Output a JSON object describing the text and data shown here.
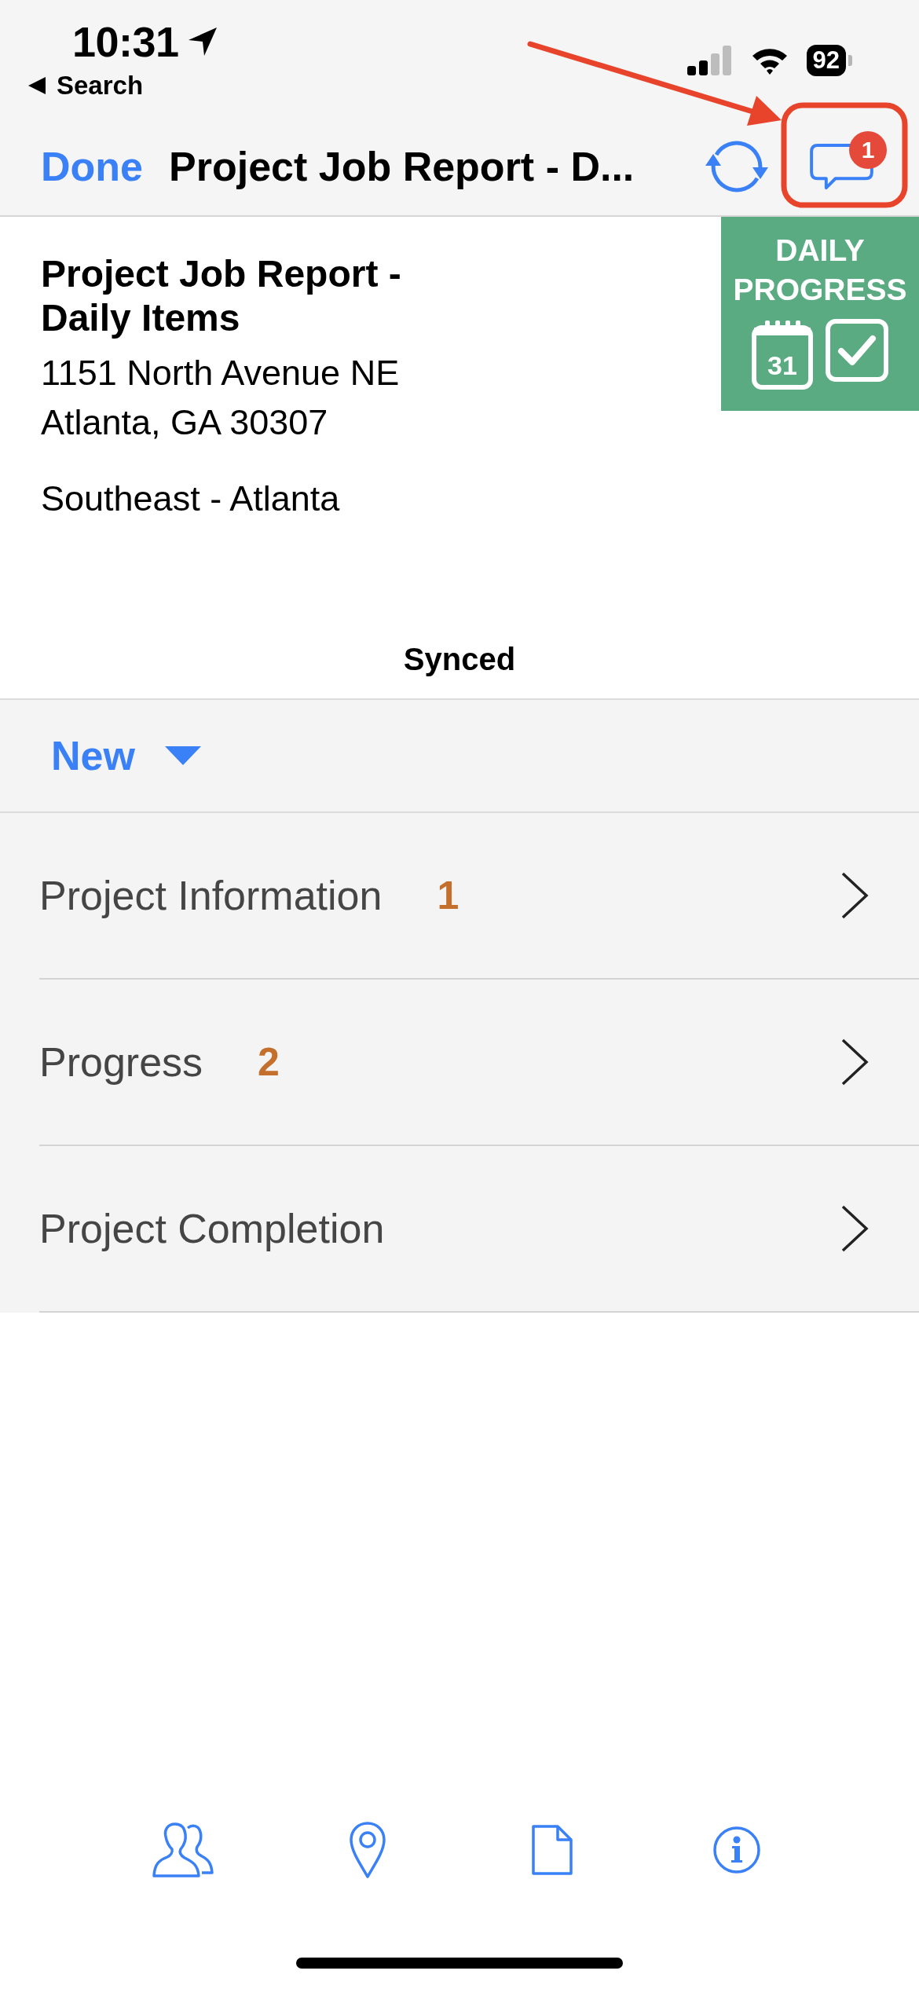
{
  "status_bar": {
    "time": "10:31",
    "back_label": "Search",
    "battery": "92"
  },
  "nav_bar": {
    "done_label": "Done",
    "title": "Project Job Report - D...",
    "message_count": "1"
  },
  "report": {
    "title": "Project Job Report - Daily Items",
    "address_lines": [
      "1151 North Avenue NE",
      "Atlanta, GA 30307"
    ],
    "region": "Southeast - Atlanta",
    "banner": {
      "lines": [
        "DAILY",
        "PROGRESS"
      ],
      "calendar_day": "31"
    }
  },
  "sync_status": "Synced",
  "toolbar": {
    "new_label": "New"
  },
  "sections": [
    {
      "label": "Project Information",
      "count": "1"
    },
    {
      "label": "Progress",
      "count": "2"
    },
    {
      "label": "Project Completion"
    }
  ],
  "tab_bar": [
    {
      "kind": "people"
    },
    {
      "kind": "location"
    },
    {
      "kind": "document"
    },
    {
      "kind": "info"
    }
  ]
}
